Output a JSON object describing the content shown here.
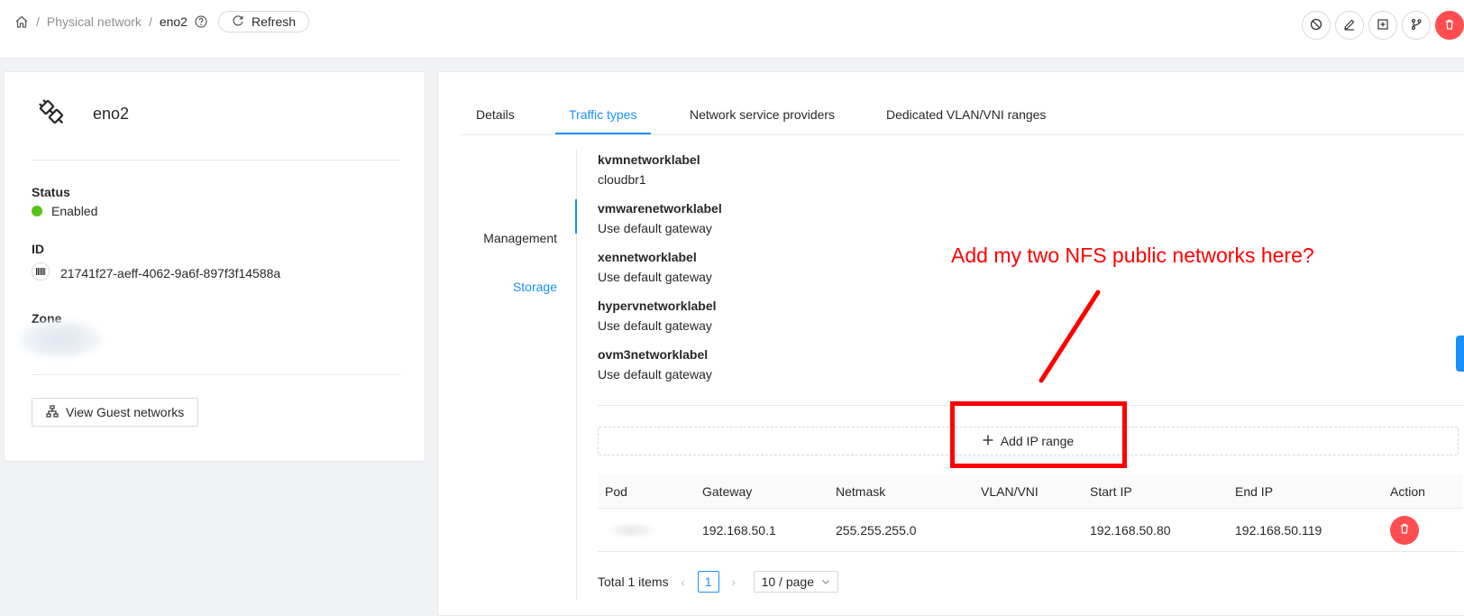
{
  "breadcrumb": {
    "home_icon": "home-icon",
    "items": [
      "Physical network",
      "eno2"
    ],
    "separator": "/"
  },
  "header": {
    "refresh_label": "Refresh",
    "actions": [
      "disable-icon",
      "edit-icon",
      "add-icon",
      "branch-icon",
      "delete-icon"
    ]
  },
  "resource": {
    "icon": "plug-icon",
    "name": "eno2",
    "status_label": "Status",
    "status_value": "Enabled",
    "status_color": "#52c41a",
    "id_label": "ID",
    "id_value": "21741f27-aeff-4062-9a6f-897f3f14588a",
    "zone_label": "Zone",
    "view_guest_label": "View Guest networks"
  },
  "tabs": [
    "Details",
    "Traffic types",
    "Network service providers",
    "Dedicated VLAN/VNI ranges"
  ],
  "active_tab": "Traffic types",
  "traffic_types": [
    "Management",
    "Storage"
  ],
  "active_traffic_type": "Storage",
  "labels": [
    {
      "key": "kvmnetworklabel",
      "value": "cloudbr1"
    },
    {
      "key": "vmwarenetworklabel",
      "value": "Use default gateway"
    },
    {
      "key": "xennetworklabel",
      "value": "Use default gateway"
    },
    {
      "key": "hypervnetworklabel",
      "value": "Use default gateway"
    },
    {
      "key": "ovm3networklabel",
      "value": "Use default gateway"
    }
  ],
  "annotation": {
    "text": "Add my two NFS public networks here?",
    "color": "#ff0000"
  },
  "add_ip_range_label": "Add IP range",
  "table": {
    "columns": [
      "Pod",
      "Gateway",
      "Netmask",
      "VLAN/VNI",
      "Start IP",
      "End IP",
      "Action"
    ],
    "rows": [
      {
        "pod": "",
        "gateway": "192.168.50.1",
        "netmask": "255.255.255.0",
        "vlan": "",
        "start_ip": "192.168.50.80",
        "end_ip": "192.168.50.119"
      }
    ]
  },
  "pagination": {
    "total_label": "Total 1 items",
    "current_page": "1",
    "page_size": "10 / page"
  },
  "colors": {
    "accent": "#1890ff",
    "danger": "#ff4d4f"
  }
}
